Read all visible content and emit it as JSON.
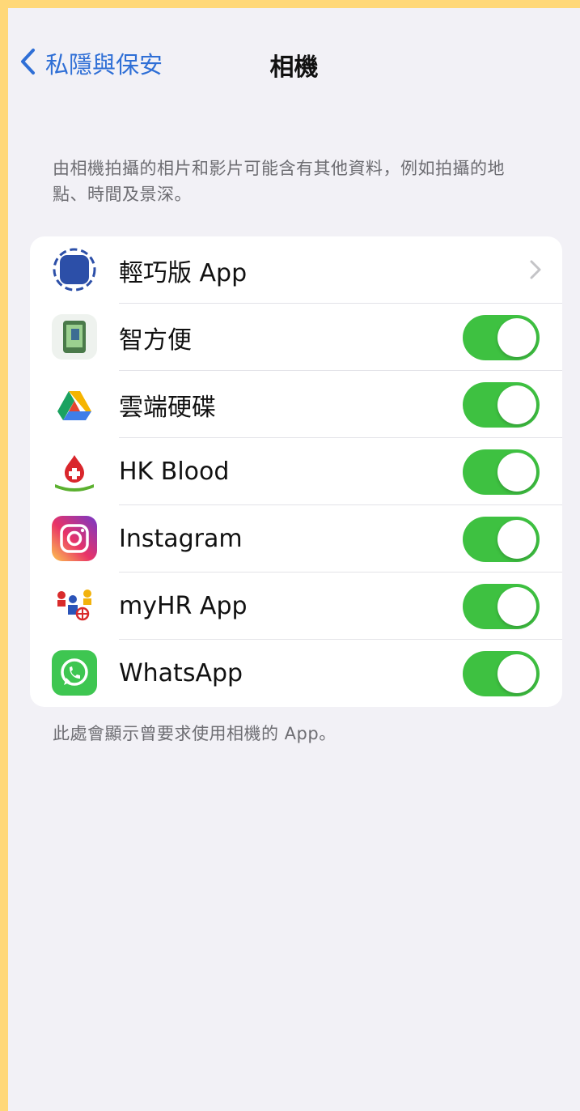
{
  "nav": {
    "back_label": "私隱與保安",
    "title": "相機"
  },
  "description": "由相機拍攝的相片和影片可能含有其他資料，例如拍攝的地點、時間及景深。",
  "apps": [
    {
      "name": "輕巧版 App",
      "icon": "app-clip-icon",
      "control": "chevron"
    },
    {
      "name": "智方便",
      "icon": "iamsmart-icon",
      "control": "toggle",
      "enabled": true
    },
    {
      "name": "雲端硬碟",
      "icon": "google-drive-icon",
      "control": "toggle",
      "enabled": true
    },
    {
      "name": "HK Blood",
      "icon": "hk-blood-icon",
      "control": "toggle",
      "enabled": true
    },
    {
      "name": "Instagram",
      "icon": "instagram-icon",
      "control": "toggle",
      "enabled": true
    },
    {
      "name": "myHR App",
      "icon": "myhr-icon",
      "control": "toggle",
      "enabled": true
    },
    {
      "name": "WhatsApp",
      "icon": "whatsapp-icon",
      "control": "toggle",
      "enabled": true
    }
  ],
  "footer": "此處會顯示曾要求使用相機的 App。",
  "colors": {
    "accent": "#2f6fd6",
    "toggle_on": "#3ec141",
    "background": "#f2f1f6"
  }
}
